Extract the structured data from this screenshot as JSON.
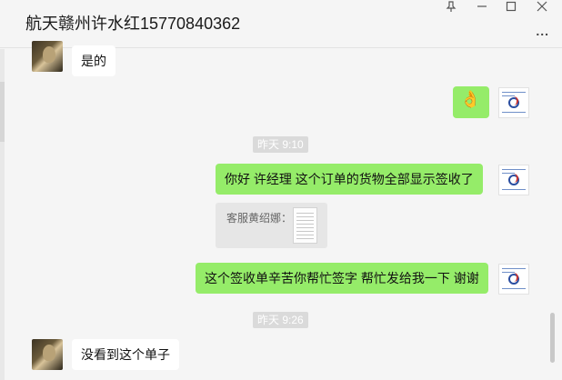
{
  "window": {
    "title": "航天赣州许水红15770840362",
    "controls": {
      "pin_icon": "pin-icon",
      "minimize_icon": "minimize-icon",
      "maximize_icon": "maximize-icon",
      "close_icon": "close-icon"
    },
    "more_label": "...",
    "more_icon": "more-icon"
  },
  "messages": [
    {
      "side": "left",
      "type": "text",
      "text": "是的"
    },
    {
      "side": "right",
      "type": "emoji",
      "emoji": "👌"
    },
    {
      "type": "time",
      "text": "昨天 9:10"
    },
    {
      "side": "right",
      "type": "text",
      "text": "你好 许经理  这个订单的货物全部显示签收了"
    },
    {
      "side": "right",
      "type": "quote",
      "quote_label": "客服黄绍娜："
    },
    {
      "side": "right",
      "type": "text",
      "text": "这个签收单辛苦你帮忙签字 帮忙发给我一下 谢谢"
    },
    {
      "type": "time",
      "text": "昨天 9:26"
    },
    {
      "side": "left",
      "type": "text",
      "text": "没看到这个单子"
    }
  ],
  "colors": {
    "self_bubble": "#95ec69",
    "other_bubble": "#ffffff",
    "background": "#f5f5f5",
    "timestamp_bg": "#dadada"
  }
}
